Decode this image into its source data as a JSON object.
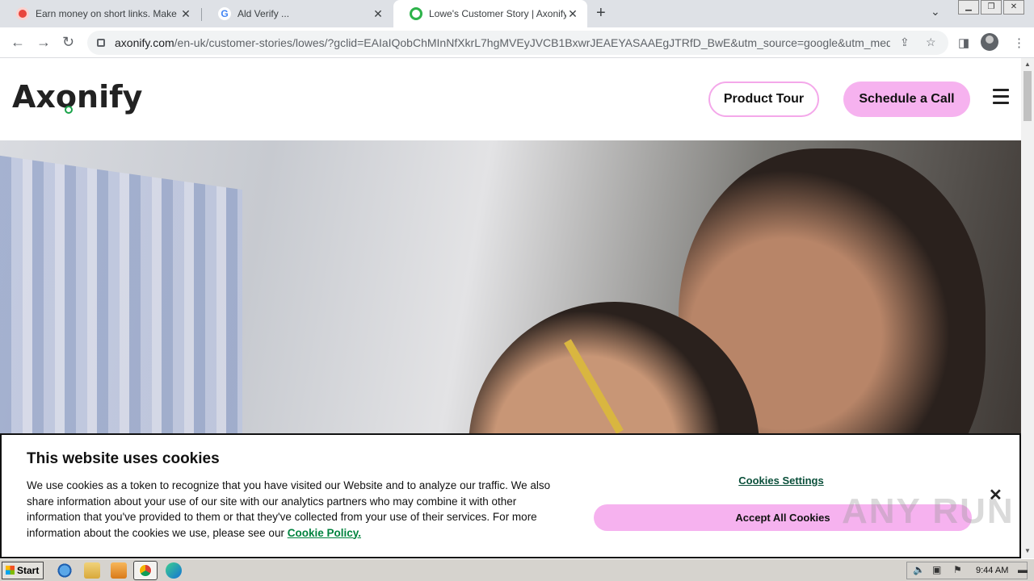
{
  "browser": {
    "tabs": [
      {
        "title": "Earn money on short links. Make sho",
        "favicon": "red-circle-icon",
        "active": false
      },
      {
        "title": "Ald Verify ...",
        "favicon": "google-icon",
        "active": false
      },
      {
        "title": "Lowe's Customer Story | Axonify",
        "favicon": "axonify-icon",
        "active": true
      }
    ],
    "new_tab_label": "+",
    "url_host": "axonify.com",
    "url_path": "/en-uk/customer-stories/lowes/?gclid=EAIaIQobChMInNfXkrL7hgMVEyJVCB1BxwrJEAEYASAAEgJTRfD_BwE&utm_source=google&utm_mediu..."
  },
  "site": {
    "logo_text": "Axonify",
    "product_tour_label": "Product Tour",
    "schedule_call_label": "Schedule a Call",
    "brand_green": "#1aa34a",
    "brand_pink": "#f6b2ef"
  },
  "cookie_banner": {
    "title": "This website uses cookies",
    "body": "We use cookies as a token to recognize that you have visited our Website and to analyze our traffic. We also share information about your use of our site with our analytics partners who may combine it with other information that you've provided to them or that they've collected from your use of their services. For more information about the cookies we use, please see our ",
    "policy_link": "Cookie Policy.",
    "settings_label": "Cookies Settings",
    "accept_label": "Accept All Cookies",
    "close_label": "✕"
  },
  "watermark": "ANY RUN",
  "taskbar": {
    "start_label": "Start",
    "clock": "9:44 AM"
  }
}
